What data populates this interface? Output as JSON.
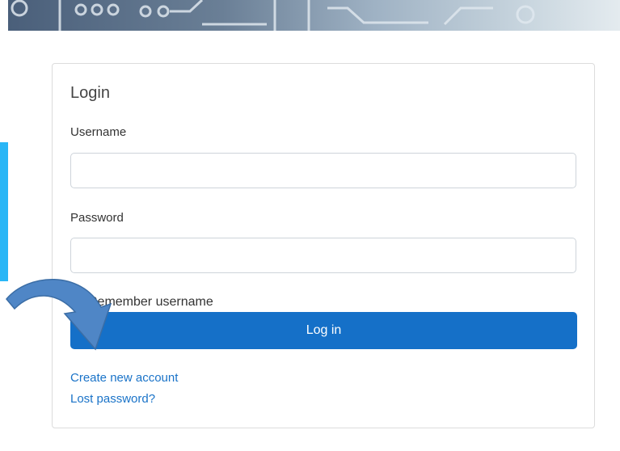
{
  "login": {
    "title": "Login",
    "username_label": "Username",
    "username_value": "",
    "password_label": "Password",
    "password_value": "",
    "remember_label": "Remember username",
    "remember_checked": false,
    "submit_label": "Log in",
    "create_account_link": "Create new account",
    "lost_password_link": "Lost password?"
  },
  "colors": {
    "primary": "#1570c8",
    "link": "#1a73c8",
    "annotation_arrow": "#4f86c6",
    "side_strip": "#29b6f6"
  },
  "annotation": {
    "icon": "curved-arrow-icon",
    "points_to": "create-account-link"
  }
}
